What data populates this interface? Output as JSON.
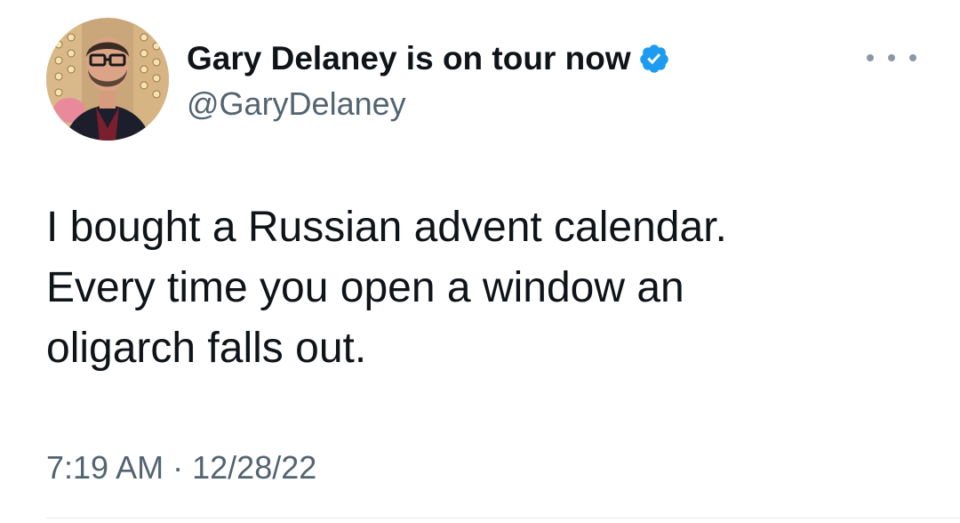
{
  "author": {
    "display_name": "Gary Delaney is on tour now",
    "handle": "@GaryDelaney",
    "verified": true,
    "verified_color": "#1d9bf0"
  },
  "tweet": {
    "lines": [
      "I bought a Russian advent calendar.",
      "Every time you open a window an",
      "oligarch falls out."
    ]
  },
  "meta": {
    "time": "7:19 AM",
    "separator": "·",
    "date": "12/28/22"
  },
  "icons": {
    "more": "more-horizontal-icon",
    "verified": "verified-badge-icon"
  }
}
